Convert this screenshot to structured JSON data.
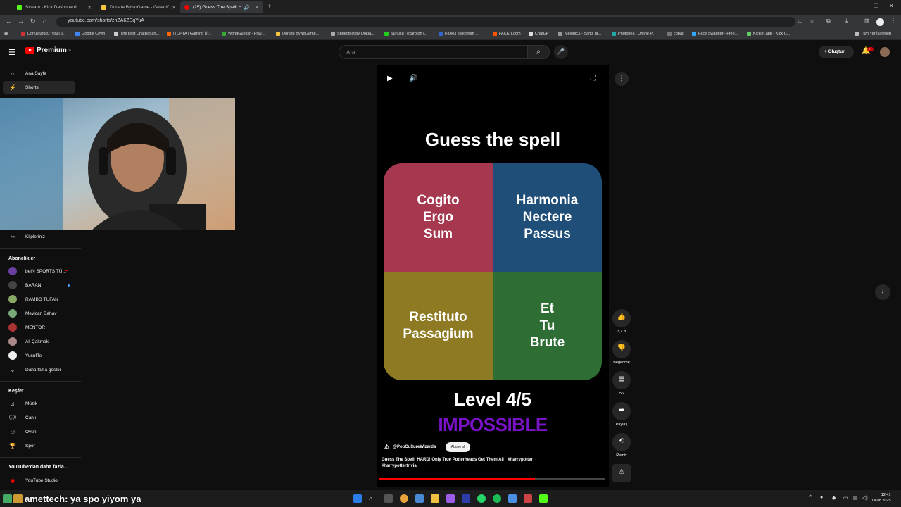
{
  "browser": {
    "tabs": [
      {
        "title": "Stream - Kick Dashboard",
        "color": "#53fc18"
      },
      {
        "title": "Donate ByNoGame - Gelen/Gi̇",
        "color": "#f5c542"
      },
      {
        "title": "(25) Guess The Spell! HARD",
        "color": "#ff0000"
      }
    ],
    "url": "youtube.com/shorts/zhZA6ZEqYuA",
    "bookmarks": [
      {
        "label": "Dönüştürücü: YouTu...",
        "color": "#c33"
      },
      {
        "label": "Google Çeviri",
        "color": "#4285f4"
      },
      {
        "label": "The best ChatBot an...",
        "color": "#ccc"
      },
      {
        "label": "ITOPYA | Gaming Ür...",
        "color": "#f60"
      },
      {
        "label": "WorldGuessr - Play...",
        "color": "#3a3"
      },
      {
        "label": "Donate ByNoGame...",
        "color": "#f5c542"
      },
      {
        "label": "Speedtest by Ookla...",
        "color": "#aaa"
      },
      {
        "label": "Sunucu | exaroton |...",
        "color": "#2c2"
      },
      {
        "label": "e-Okul İlköğretim ...",
        "color": "#36c"
      },
      {
        "label": "FACEIT.com",
        "color": "#f50"
      },
      {
        "label": "ChatGPT",
        "color": "#ddd"
      },
      {
        "label": "MelodicX - Şarkı Ta...",
        "color": "#999"
      },
      {
        "label": "Photopea | Online P...",
        "color": "#2aa"
      },
      {
        "label": "cobalt",
        "color": "#777"
      },
      {
        "label": "Face Swapper - Free...",
        "color": "#3af"
      },
      {
        "label": "Kicklet.app - Kick C...",
        "color": "#6c6"
      }
    ],
    "all_bookmarks": "Tüm Yer İşaretleri"
  },
  "yt": {
    "logo": "Premium",
    "logo_sup": "TR",
    "search_placeholder": "Ara",
    "create": "Oluştur",
    "notif_count": "9+"
  },
  "sidebar": {
    "home": "Ana Sayfa",
    "shorts": "Shorts",
    "clips": "Klipleriniz",
    "subs_header": "Abonelikler",
    "subs": [
      {
        "name": "beIN SPORTS TÜ...",
        "color": "#6a3fa0"
      },
      {
        "name": "BARAN",
        "color": "#444"
      },
      {
        "name": "RAMBO TUFAN",
        "color": "#8a6"
      },
      {
        "name": "Mevlcan Bahav",
        "color": "#7a7"
      },
      {
        "name": "MENTOR",
        "color": "#a33"
      },
      {
        "name": "Ali Çakmak",
        "color": "#a88"
      },
      {
        "name": "YusufTe",
        "color": "#eee"
      }
    ],
    "show_more": "Daha fazla göster",
    "explore_header": "Keşfet",
    "explore": [
      {
        "label": "Müzik",
        "icon": "♫"
      },
      {
        "label": "Canlı",
        "icon": "((·))"
      },
      {
        "label": "Oyun",
        "icon": "⚇"
      },
      {
        "label": "Spor",
        "icon": "☂"
      }
    ],
    "more_header": "YouTube'dan daha fazla...",
    "studio": "YouTube Studio"
  },
  "short": {
    "title": "Guess the spell",
    "options": [
      "Cogito\nErgo\nSum",
      "Harmonia\nNectere\nPassus",
      "Restituto\nPassagium",
      "Et\nTu\nBrute"
    ],
    "quad_colors": [
      "#a5384f",
      "#1f4e78",
      "#8d7a22",
      "#2e6e35"
    ],
    "level": "Level 4/5",
    "difficulty": "IMPOSSIBLE",
    "channel": "@PopCultureWizards",
    "subscribe": "Abone ol",
    "description": "Guess The Spell! HARD! Only True Potterheads Get Them All",
    "tags": [
      "#harrypotter",
      "#harrypottertrivia"
    ],
    "progress": 0.69
  },
  "actions": {
    "likes": "3,7 B",
    "dislike": "Beğenme",
    "comments": "56",
    "share": "Paylaş",
    "remix": "Remix"
  },
  "overlay": {
    "chat_user": "amettech",
    "chat_msg": ": ya spo yiyom ya"
  },
  "taskbar": {
    "time": "12:41",
    "date": "14.08.2025"
  }
}
